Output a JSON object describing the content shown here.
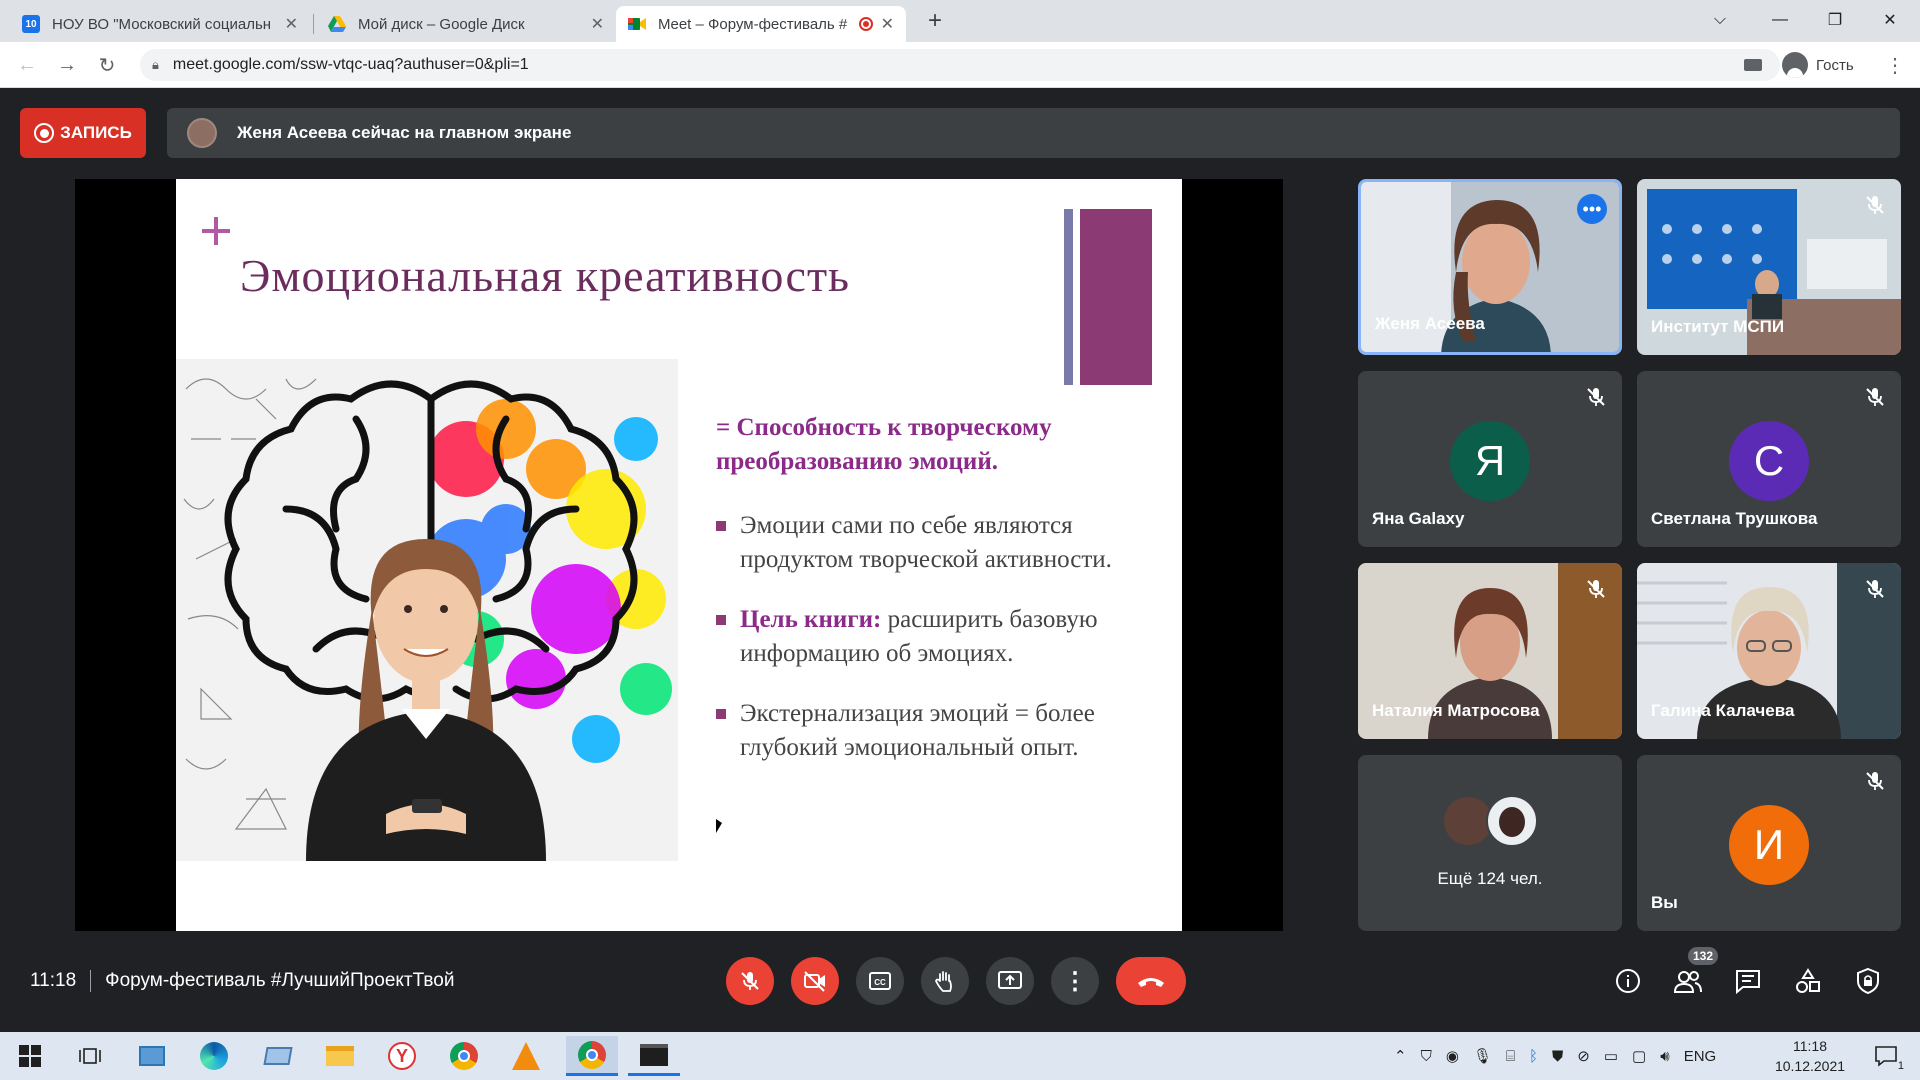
{
  "browser": {
    "tabs": [
      {
        "title": "НОУ ВО \"Московский социальн",
        "favicon_label": "10",
        "favicon_color": "#1a73e8"
      },
      {
        "title": "Мой диск – Google Диск",
        "favicon_color": "#fbbc04"
      },
      {
        "title": "Meet – Форум-фестиваль #",
        "favicon_color": "#00832d"
      }
    ],
    "url": "meet.google.com/ssw-vtqc-uaq?authuser=0&pli=1",
    "profile_label": "Гость"
  },
  "meet": {
    "record_label": "ЗАПИСЬ",
    "banner_text": "Женя Асеева сейчас на главном экране",
    "time": "11:18",
    "meeting_title": "Форум-фестиваль #ЛучшийПроектТвой",
    "participants_count": "132",
    "slide": {
      "title": "Эмоциональная креативность",
      "definition": "= Способность к творческому преобразованию эмоций.",
      "bullets": [
        {
          "bold": "",
          "text": "Эмоции сами по себе являются продуктом творческой активности."
        },
        {
          "bold": "Цель книги:",
          "text": " расширить базовую информацию об эмоциях."
        },
        {
          "bold": "",
          "text": "Экстернализация эмоций = более глубокий эмоциональный опыт."
        }
      ],
      "accent_color": "#8b3a74"
    },
    "tiles": [
      {
        "name": "Женя Асеева",
        "kind": "video"
      },
      {
        "name": "Институт МСПИ",
        "kind": "video"
      },
      {
        "name": "Яна Galaxy",
        "initial": "Я",
        "color": "#0b5e4a"
      },
      {
        "name": "Светлана Трушкова",
        "initial": "С",
        "color": "#5b2bb5"
      },
      {
        "name": "Наталия Матросова",
        "kind": "video"
      },
      {
        "name": "Галина Калачева",
        "kind": "video"
      },
      {
        "name": "Ещё 124 чел.",
        "kind": "more"
      },
      {
        "name": "Вы",
        "initial": "И",
        "color": "#f06d0a"
      }
    ]
  },
  "taskbar": {
    "lang": "ENG",
    "clock_time": "11:18",
    "clock_date": "10.12.2021",
    "notifications": "1"
  }
}
